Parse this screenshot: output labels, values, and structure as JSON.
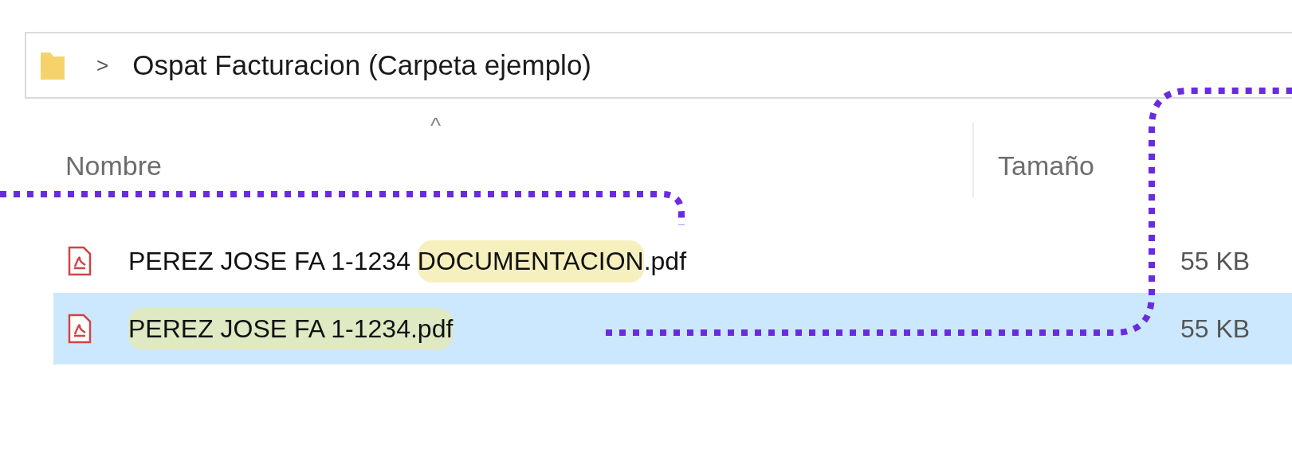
{
  "address_bar": {
    "separator": ">",
    "path": "Ospat Facturacion (Carpeta ejemplo)"
  },
  "columns": [
    {
      "label": "Nombre",
      "sorted": true
    },
    {
      "label": "Tamaño",
      "sorted": false
    }
  ],
  "sort_indicator": "^",
  "files": [
    {
      "name_parts": [
        {
          "text": "PEREZ JOSE FA 1-1234 ",
          "highlighted": false
        },
        {
          "text": "DOCUMENTACION",
          "highlighted": true
        },
        {
          "text": ".pdf",
          "highlighted": false
        }
      ],
      "size": "55 KB",
      "selected": false
    },
    {
      "name_parts": [
        {
          "text": "PEREZ JOSE FA 1-1234.pdf",
          "highlighted": true
        }
      ],
      "size": "55 KB",
      "selected": true
    }
  ]
}
